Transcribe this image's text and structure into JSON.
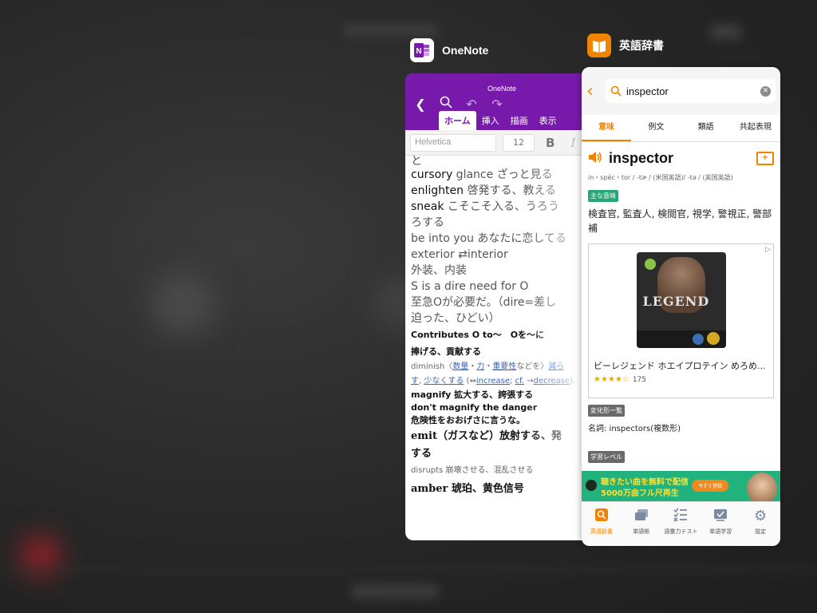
{
  "switcher": {
    "apps": [
      {
        "name": "OneNote",
        "accent": "#7719aa",
        "icon": "onenote-icon"
      },
      {
        "name": "英語辞書",
        "accent": "#f08300",
        "icon": "dictionary-icon"
      }
    ]
  },
  "onenote": {
    "header_title": "OneNote",
    "tabs": [
      "ホーム",
      "挿入",
      "描画",
      "表示"
    ],
    "active_tab": "ホーム",
    "format": {
      "font": "Helvetica",
      "size": "12",
      "bold": "B",
      "italic": "I"
    },
    "lines": {
      "l1": "と",
      "l2_a": "cursory",
      "l2_b": " glance ざっと見る",
      "l3_a": "enlighten",
      "l3_b": " 啓発する、教える",
      "l4_a": "sneak",
      "l4_b": " こそこそ入る、うろう",
      "l5": "ろする",
      "l6": "be into you あなたに恋してる",
      "l7": "exterior ⇄interior",
      "l8": "外装、内装",
      "l9": "S is a dire need for O",
      "l10": "至急Oが必要だ。（dire=差し",
      "l11": "迫った、ひどい）",
      "l12": "Contributes O to〜　Oを〜に",
      "l13": "捧げる、貢献する",
      "l14_a": "diminish〈",
      "l14_links": [
        "数量",
        "力",
        "重要性"
      ],
      "l14_b": "などを〉",
      "l14_link4": "減ら",
      "l15_link1": "す",
      "l15_link2": "少なくする",
      "l15_b": " (⇔",
      "l15_link3": "increase",
      "l15_c": "; ",
      "l15_link4": "cf.",
      "l15_d": " →",
      "l15_link5": "decrease",
      "l15_e": ").",
      "l16": "magnify 拡大する、誇張する",
      "l17": "don't magnify the danger",
      "l18": "危険性をおおげさに言うな。",
      "l19_a": "emit",
      "l19_b": "（ガスなど）放射する、発",
      "l20": "する",
      "l21": "disrupts 崩壊させる、混乱させる",
      "l22": "amber 琥珀、黄色信号"
    }
  },
  "dictionary": {
    "search_value": "inspector",
    "tabs": [
      "意味",
      "例文",
      "類語",
      "共起表現"
    ],
    "active_tab": "意味",
    "word": "inspector",
    "pronunciation": "in・spéc・tor / -tɚ / (米国英語)/ -tə / (英国英語)",
    "main_meaning_label": "主な意味",
    "main_meaning": "検査官, 監査人, 検閲官, 視学, 警視正, 警部補",
    "ad": {
      "image_text": "LEGEND",
      "title": "ビーレジェンド ホエイプロテイン めろめ...",
      "stars": "★★★★☆",
      "rating_count": "175"
    },
    "inflection_label": "変化形一覧",
    "inflection": "名詞: inspectors(複数形)",
    "level_label": "学習レベル",
    "banner": {
      "line1": "聴きたい曲を無料で配信",
      "line2": "5000万曲フル尺再生",
      "button": "今すぐ登録"
    },
    "bottom_nav": [
      {
        "label": "英語辞書",
        "icon": "dictionary-search-icon"
      },
      {
        "label": "単語帳",
        "icon": "cards-icon"
      },
      {
        "label": "語彙力テスト",
        "icon": "checklist-icon"
      },
      {
        "label": "単語学習",
        "icon": "study-icon"
      },
      {
        "label": "設定",
        "icon": "gear-icon"
      }
    ]
  }
}
